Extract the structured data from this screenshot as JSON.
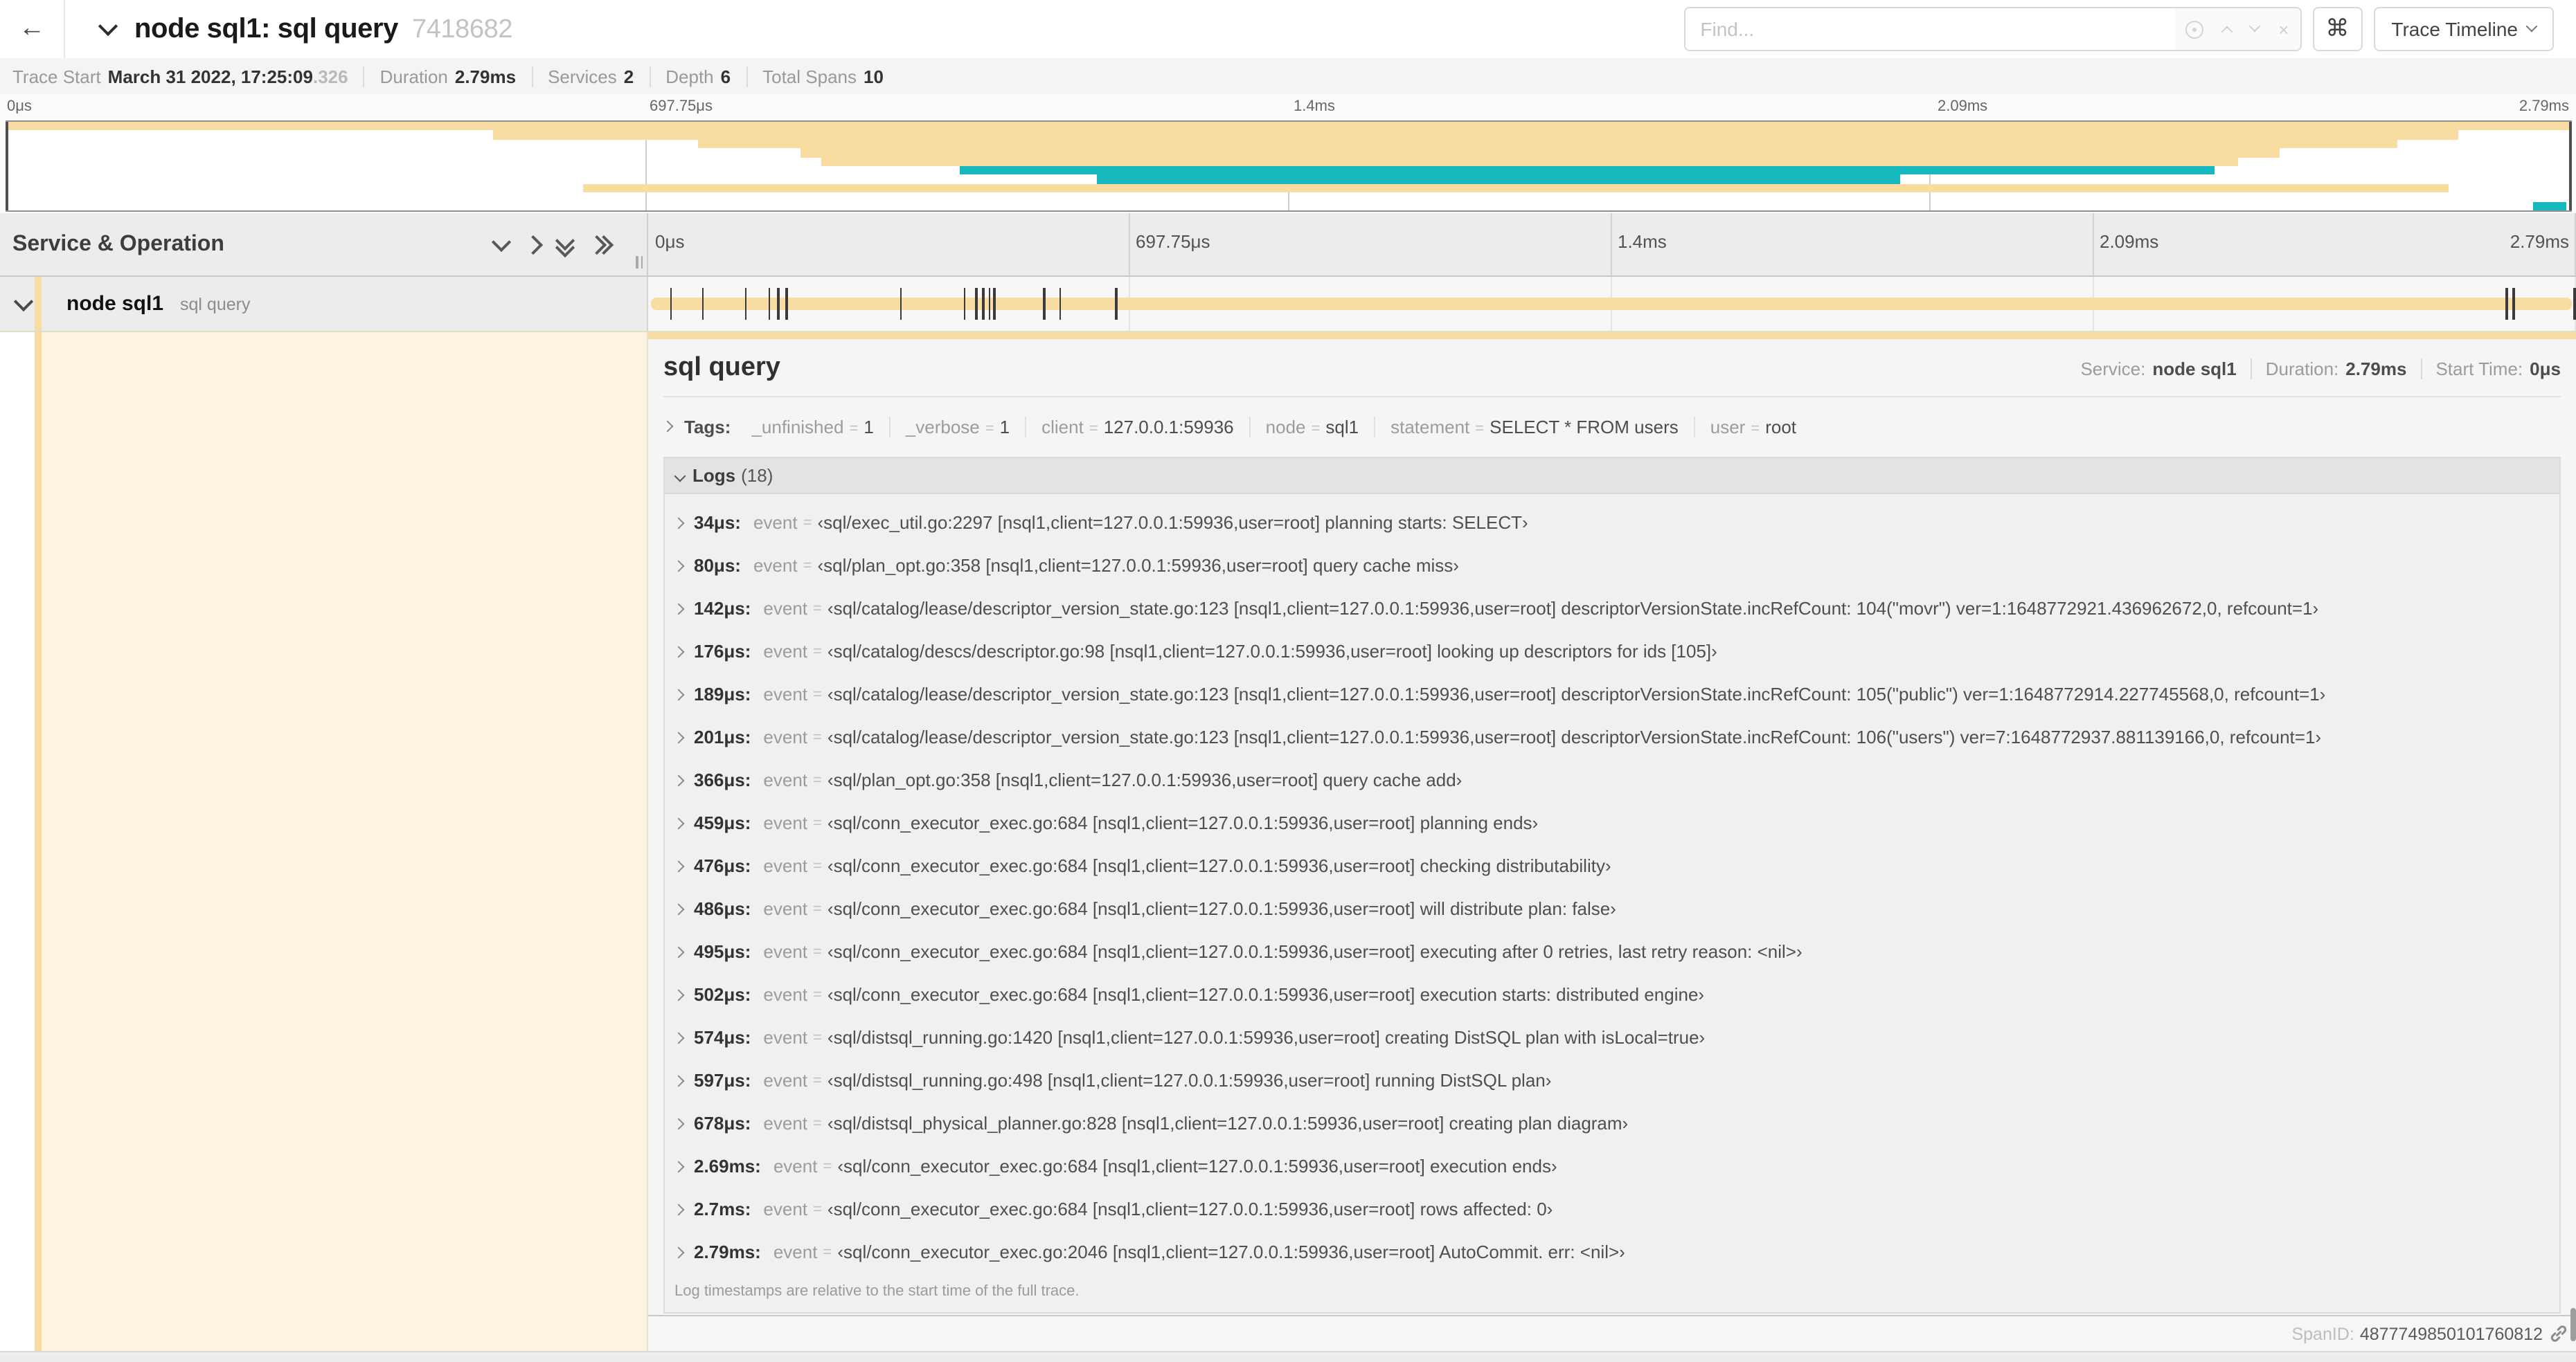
{
  "colors": {
    "span_tan": "#F8DCA1",
    "span_teal": "#17B8BE",
    "detail_tint": "#FDF4E0"
  },
  "header": {
    "back_glyph": "←",
    "title": "node sql1: sql query",
    "trace_id": "7418682",
    "find_placeholder": "Find...",
    "shortcut_glyph": "⌘",
    "view_selector": "Trace Timeline"
  },
  "trace_bar": {
    "items": [
      {
        "label": "Trace Start",
        "value": "March 31 2022, 17:25:09",
        "suffix": ".326"
      },
      {
        "label": "Duration",
        "value": "2.79ms"
      },
      {
        "label": "Services",
        "value": "2"
      },
      {
        "label": "Depth",
        "value": "6"
      },
      {
        "label": "Total Spans",
        "value": "10"
      }
    ]
  },
  "ticks": [
    "0μs",
    "697.75μs",
    "1.4ms",
    "2.09ms",
    "2.79ms"
  ],
  "minimap": {
    "spans": [
      {
        "row": 0,
        "start": 0.0,
        "end": 1.0,
        "color": "span_tan"
      },
      {
        "row": 1,
        "start": 0.19,
        "end": 0.956,
        "color": "span_tan"
      },
      {
        "row": 2,
        "start": 0.27,
        "end": 0.932,
        "color": "span_tan"
      },
      {
        "row": 3,
        "start": 0.31,
        "end": 0.886,
        "color": "span_tan"
      },
      {
        "row": 4,
        "start": 0.318,
        "end": 0.87,
        "color": "span_tan"
      },
      {
        "row": 5,
        "start": 0.372,
        "end": 0.861,
        "color": "span_teal"
      },
      {
        "row": 6,
        "start": 0.425,
        "end": 0.738,
        "color": "span_teal"
      },
      {
        "row": 7,
        "start": 0.225,
        "end": 0.952,
        "color": "span_tan"
      },
      {
        "row": 9,
        "start": 0.985,
        "end": 0.998,
        "color": "span_teal"
      }
    ]
  },
  "timeline": {
    "left_header": "Service & Operation",
    "row": {
      "service": "node sql1",
      "operation": "sql query",
      "color": "span_tan",
      "log_marker_fractions": [
        0.0122,
        0.0287,
        0.0509,
        0.0631,
        0.0677,
        0.072,
        0.1312,
        0.1645,
        0.1706,
        0.1742,
        0.1774,
        0.1799,
        0.2057,
        0.214,
        0.243,
        0.9642,
        0.9677,
        0.9996
      ]
    }
  },
  "detail": {
    "title": "sql query",
    "meta": [
      {
        "label": "Service:",
        "value": "node sql1"
      },
      {
        "label": "Duration:",
        "value": "2.79ms"
      },
      {
        "label": "Start Time:",
        "value": "0μs"
      }
    ],
    "equals": "=",
    "tags": {
      "label": "Tags:",
      "items": [
        {
          "key": "_unfinished",
          "value": "1"
        },
        {
          "key": "_verbose",
          "value": "1"
        },
        {
          "key": "client",
          "value": "127.0.0.1:59936"
        },
        {
          "key": "node",
          "value": "sql1"
        },
        {
          "key": "statement",
          "value": "SELECT * FROM users"
        },
        {
          "key": "user",
          "value": "root"
        }
      ]
    },
    "logs": {
      "label": "Logs",
      "count": "(18)",
      "field": "event",
      "entries": [
        {
          "time": "34μs:",
          "value": "‹sql/exec_util.go:2297 [nsql1,client=127.0.0.1:59936,user=root] planning starts: SELECT›"
        },
        {
          "time": "80μs:",
          "value": "‹sql/plan_opt.go:358 [nsql1,client=127.0.0.1:59936,user=root] query cache miss›"
        },
        {
          "time": "142μs:",
          "value": "‹sql/catalog/lease/descriptor_version_state.go:123 [nsql1,client=127.0.0.1:59936,user=root] descriptorVersionState.incRefCount: 104(\"movr\") ver=1:1648772921.436962672,0, refcount=1›"
        },
        {
          "time": "176μs:",
          "value": "‹sql/catalog/descs/descriptor.go:98 [nsql1,client=127.0.0.1:59936,user=root] looking up descriptors for ids [105]›"
        },
        {
          "time": "189μs:",
          "value": "‹sql/catalog/lease/descriptor_version_state.go:123 [nsql1,client=127.0.0.1:59936,user=root] descriptorVersionState.incRefCount: 105(\"public\") ver=1:1648772914.227745568,0, refcount=1›"
        },
        {
          "time": "201μs:",
          "value": "‹sql/catalog/lease/descriptor_version_state.go:123 [nsql1,client=127.0.0.1:59936,user=root] descriptorVersionState.incRefCount: 106(\"users\") ver=7:1648772937.881139166,0, refcount=1›"
        },
        {
          "time": "366μs:",
          "value": "‹sql/plan_opt.go:358 [nsql1,client=127.0.0.1:59936,user=root] query cache add›"
        },
        {
          "time": "459μs:",
          "value": "‹sql/conn_executor_exec.go:684 [nsql1,client=127.0.0.1:59936,user=root] planning ends›"
        },
        {
          "time": "476μs:",
          "value": "‹sql/conn_executor_exec.go:684 [nsql1,client=127.0.0.1:59936,user=root] checking distributability›"
        },
        {
          "time": "486μs:",
          "value": "‹sql/conn_executor_exec.go:684 [nsql1,client=127.0.0.1:59936,user=root] will distribute plan: false›"
        },
        {
          "time": "495μs:",
          "value": "‹sql/conn_executor_exec.go:684 [nsql1,client=127.0.0.1:59936,user=root] executing after 0 retries, last retry reason: <nil>›"
        },
        {
          "time": "502μs:",
          "value": "‹sql/conn_executor_exec.go:684 [nsql1,client=127.0.0.1:59936,user=root] execution starts: distributed engine›"
        },
        {
          "time": "574μs:",
          "value": "‹sql/distsql_running.go:1420 [nsql1,client=127.0.0.1:59936,user=root] creating DistSQL plan with isLocal=true›"
        },
        {
          "time": "597μs:",
          "value": "‹sql/distsql_running.go:498 [nsql1,client=127.0.0.1:59936,user=root] running DistSQL plan›"
        },
        {
          "time": "678μs:",
          "value": "‹sql/distsql_physical_planner.go:828 [nsql1,client=127.0.0.1:59936,user=root] creating plan diagram›"
        },
        {
          "time": "2.69ms:",
          "value": "‹sql/conn_executor_exec.go:684 [nsql1,client=127.0.0.1:59936,user=root] execution ends›"
        },
        {
          "time": "2.7ms:",
          "value": "‹sql/conn_executor_exec.go:684 [nsql1,client=127.0.0.1:59936,user=root] rows affected: 0›"
        },
        {
          "time": "2.79ms:",
          "value": "‹sql/conn_executor_exec.go:2046 [nsql1,client=127.0.0.1:59936,user=root] AutoCommit. err: <nil>›"
        }
      ],
      "footer": "Log timestamps are relative to the start time of the full trace."
    },
    "span_id_label": "SpanID:",
    "span_id": "4877749850101760812"
  }
}
